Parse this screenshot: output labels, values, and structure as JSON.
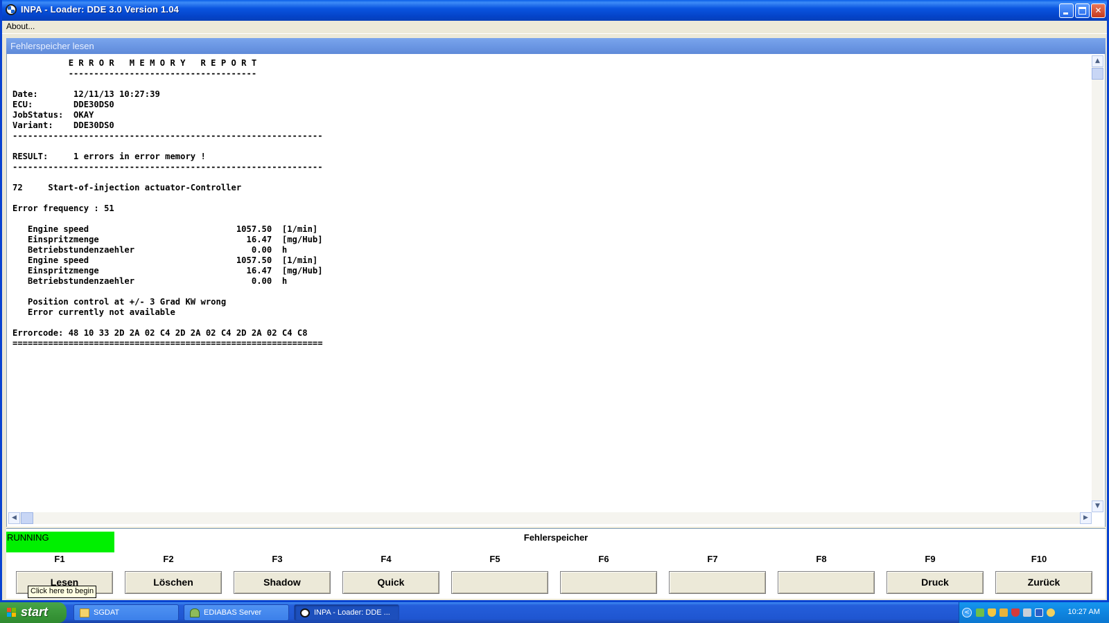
{
  "window": {
    "title": "INPA - Loader:  DDE 3.0 Version 1.04",
    "menu": [
      "About..."
    ]
  },
  "panel": {
    "title": "Fehlerspeicher lesen",
    "report_lines": [
      "           E R R O R   M E M O R Y   R E P O R T",
      "           -------------------------------------",
      "",
      "Date:       12/11/13 10:27:39",
      "ECU:        DDE30DS0",
      "JobStatus:  OKAY",
      "Variant:    DDE30DS0",
      "-------------------------------------------------------------",
      "",
      "RESULT:     1 errors in error memory !",
      "-------------------------------------------------------------",
      "",
      "72     Start-of-injection actuator-Controller",
      "",
      "Error frequency : 51",
      "",
      "   Engine speed                             1057.50  [1/min]",
      "   Einspritzmenge                             16.47  [mg/Hub]",
      "   Betriebstundenzaehler                       0.00  h",
      "   Engine speed                             1057.50  [1/min]",
      "   Einspritzmenge                             16.47  [mg/Hub]",
      "   Betriebstundenzaehler                       0.00  h",
      "",
      "   Position control at +/- 3 Grad KW wrong",
      "   Error currently not available",
      "",
      "Errorcode: 48 10 33 2D 2A 02 C4 2D 2A 02 C4 2D 2A 02 C4 C8",
      "============================================================="
    ]
  },
  "status": {
    "text": "RUNNING",
    "color": "#00f000",
    "mode": "Fehlerspeicher"
  },
  "fkeys": [
    {
      "key": "F1",
      "label": "Lesen"
    },
    {
      "key": "F2",
      "label": "Löschen"
    },
    {
      "key": "F3",
      "label": "Shadow"
    },
    {
      "key": "F4",
      "label": "Quick"
    },
    {
      "key": "F5",
      "label": ""
    },
    {
      "key": "F6",
      "label": ""
    },
    {
      "key": "F7",
      "label": ""
    },
    {
      "key": "F8",
      "label": ""
    },
    {
      "key": "F9",
      "label": "Druck"
    },
    {
      "key": "F10",
      "label": "Zurück"
    }
  ],
  "tooltip": "Click here to begin",
  "taskbar": {
    "start_label": "start",
    "tasks": [
      {
        "label": "SGDAT",
        "icon": "folder-icon",
        "active": false
      },
      {
        "label": "EDIABAS Server",
        "icon": "server-icon",
        "active": false
      },
      {
        "label": "INPA - Loader:  DDE ...",
        "icon": "bmw-icon",
        "active": true
      }
    ],
    "clock": "10:27 AM"
  }
}
